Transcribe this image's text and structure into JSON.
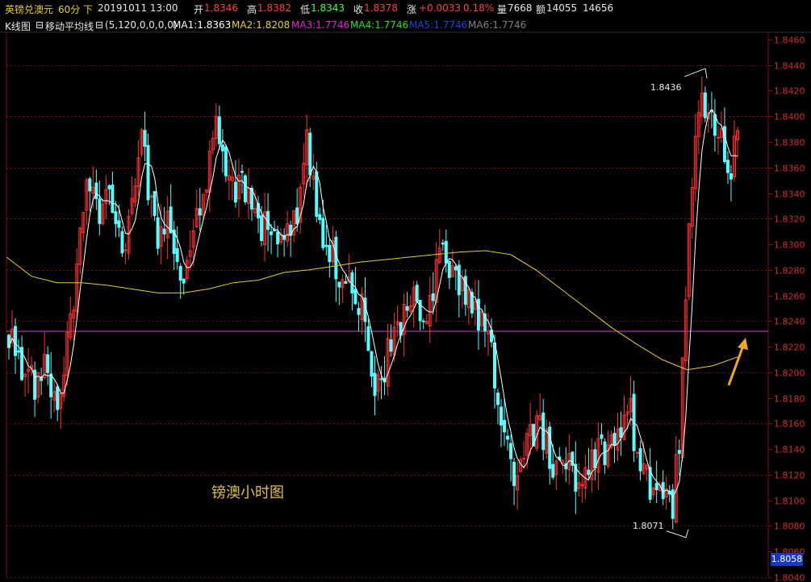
{
  "header": {
    "name": "英镑兑澳元",
    "period": "60分",
    "direction": "下",
    "datetime": "20191011 13:00",
    "open_label": "开",
    "open": "1.8346",
    "high_label": "高",
    "high": "1.8382",
    "low_label": "低",
    "low": "1.8343",
    "close_label": "收",
    "close": "1.8378",
    "change_label": "涨",
    "change": "+0.0033",
    "change_pct": "0.18%",
    "vol_label": "量",
    "vol": "7668",
    "amount_label": "额",
    "amount": "14055",
    "extra": "14656"
  },
  "indicator": {
    "chart_label": "K线图",
    "ma_label": "移动平均线",
    "params": "(5,120,0,0,0,0)",
    "ma1": "MA1:1.8363",
    "ma2": "MA2:1.8208",
    "ma3": "MA3:1.7746",
    "ma4": "MA4:1.7746",
    "ma5": "MA5:1.7746",
    "ma6": "MA6:1.7746"
  },
  "annotations": {
    "high_price": "1.8436",
    "low_price": "1.8071",
    "current_price": "1.8058",
    "caption": "镑澳小时图"
  },
  "colors": {
    "up": "#ff3030",
    "down": "#54ffff",
    "ma1": "#ffffff",
    "ma2": "#e8d020",
    "ma3": "#e020e0",
    "ma4": "#20e020",
    "ma5": "#2040e0",
    "ma6": "#808080",
    "grid": "#801010",
    "arrow": "#f0a820",
    "ref_line": "#d040d0"
  },
  "chart_data": {
    "type": "candlestick",
    "ylim": [
      1.804,
      1.8465
    ],
    "yticks": [
      "1.8460",
      "1.8440",
      "1.8420",
      "1.8400",
      "1.8380",
      "1.8360",
      "1.8340",
      "1.8320",
      "1.8300",
      "1.8280",
      "1.8260",
      "1.8240",
      "1.8220",
      "1.8200",
      "1.8180",
      "1.8160",
      "1.8140",
      "1.8120",
      "1.8100",
      "1.8080",
      "1.8060",
      "1.8040"
    ],
    "reference_level": 1.8232,
    "key_points": [
      {
        "label": "high",
        "value": 1.8436
      },
      {
        "label": "low",
        "value": 1.8071
      },
      {
        "label": "current",
        "value": 1.8058
      }
    ],
    "close_path": [
      1.8225,
      1.8215,
      1.82,
      1.819,
      1.821,
      1.8195,
      1.818,
      1.822,
      1.826,
      1.833,
      1.835,
      1.83,
      1.836,
      1.831,
      1.828,
      1.835,
      1.838,
      1.834,
      1.83,
      1.832,
      1.829,
      1.828,
      1.83,
      1.833,
      1.836,
      1.839,
      1.837,
      1.834,
      1.835,
      1.833,
      1.832,
      1.831,
      1.83,
      1.831,
      1.83,
      1.833,
      1.838,
      1.834,
      1.83,
      1.829,
      1.828,
      1.827,
      1.826,
      1.824,
      1.818,
      1.82,
      1.822,
      1.823,
      1.825,
      1.827,
      1.824,
      1.826,
      1.829,
      1.828,
      1.827,
      1.826,
      1.826,
      1.824,
      1.822,
      1.818,
      1.815,
      1.812,
      1.813,
      1.815,
      1.816,
      1.814,
      1.813,
      1.812,
      1.813,
      1.811,
      1.813,
      1.814,
      1.813,
      1.815,
      1.816,
      1.817,
      1.813,
      1.812,
      1.811,
      1.81,
      1.809,
      1.815,
      1.83,
      1.84,
      1.841,
      1.839,
      1.838,
      1.836,
      1.8378
    ],
    "ma2_path": [
      1.829,
      1.8275,
      1.827,
      1.827,
      1.8268,
      1.8265,
      1.8262,
      1.8262,
      1.8265,
      1.827,
      1.8272,
      1.8278,
      1.828,
      1.8283,
      1.8286,
      1.8288,
      1.829,
      1.8292,
      1.8294,
      1.8295,
      1.8292,
      1.828,
      1.8265,
      1.825,
      1.8235,
      1.8222,
      1.821,
      1.8202,
      1.8205,
      1.8212
    ]
  }
}
